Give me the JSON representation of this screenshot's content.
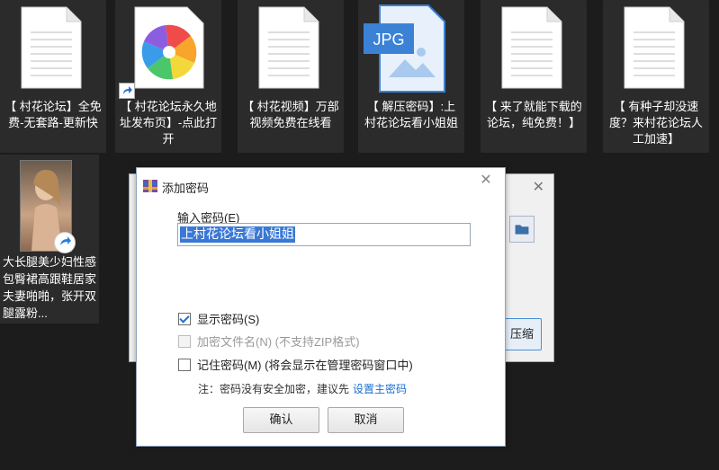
{
  "desktop": {
    "files": [
      {
        "caption": "【 村花论坛】全免费-无套路-更新快",
        "icon": "document-icon"
      },
      {
        "caption": "【 村花论坛永久地址发布页】-点此打开",
        "icon": "pinwheel-browser-icon"
      },
      {
        "caption": "【 村花视频】万部视频免费在线看",
        "icon": "document-icon"
      },
      {
        "caption": "【 解压密码】:上村花论坛看小姐姐",
        "icon": "jpg-image-icon",
        "badge": "JPG"
      },
      {
        "caption": "【 来了就能下载的论坛，纯免费！】",
        "icon": "document-icon"
      },
      {
        "caption": "【 有种子却没速度？来村花论坛人工加速】",
        "icon": "document-icon"
      }
    ],
    "video_file": {
      "caption": "大长腿美少妇性感包臀裙高跟鞋居家夫妻啪啪，张开双腿露粉..."
    }
  },
  "background_dialog": {
    "button_partial": "压缩"
  },
  "dialog": {
    "title": "添加密码",
    "close_glyph": "✕",
    "password_label": "输入密码(E)",
    "password_value": "上村花论坛看小姐姐",
    "checkboxes": [
      {
        "label": "显示密码(S)",
        "checked": true,
        "disabled": false
      },
      {
        "label": "加密文件名(N) (不支持ZIP格式)",
        "checked": false,
        "disabled": true
      },
      {
        "label": "记住密码(M) (将会显示在管理密码窗口中)",
        "checked": false,
        "disabled": false
      }
    ],
    "note_text": "注：密码没有安全加密，建议先",
    "note_link": "设置主密码",
    "ok_label": "确认",
    "cancel_label": "取消"
  }
}
